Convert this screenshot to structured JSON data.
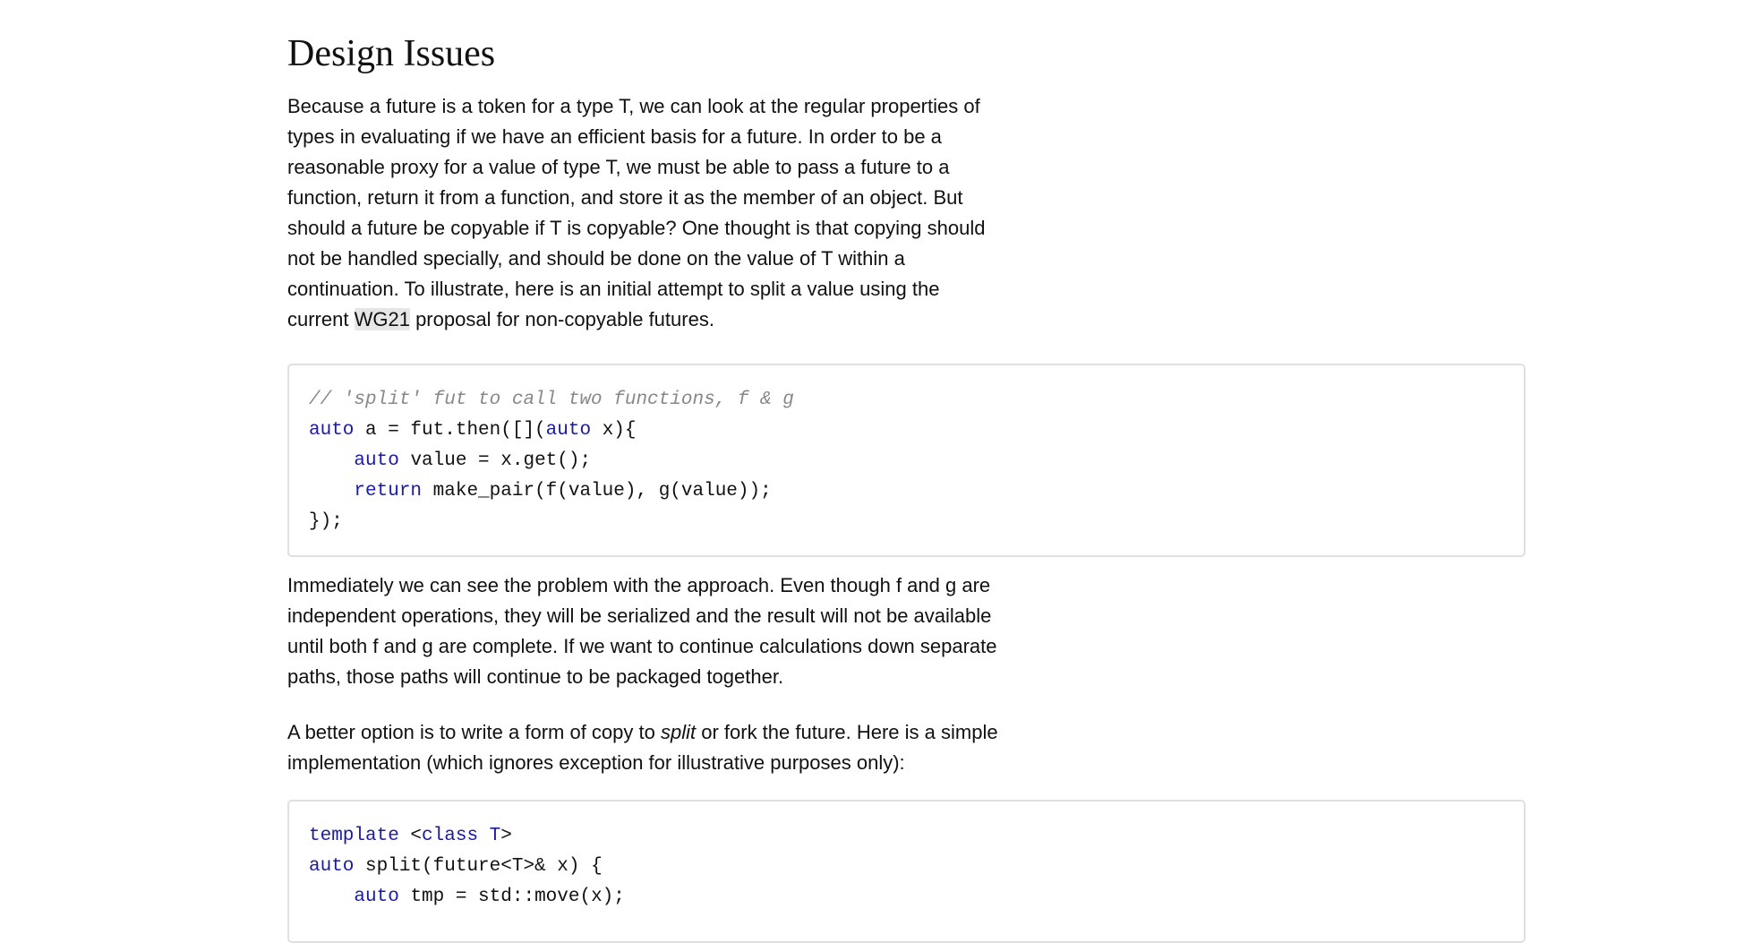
{
  "section_heading": "Design Issues",
  "para1": {
    "before": "Because a future is a token for a type T, we can look at the regular properties of types in evaluating if we have an efficient basis for a future. In order to be a reasonable proxy for a value of type T, we must be able to pass a future to a function, return it from a function, and store it as the member of an object. But should a future be copyable if T is copyable? One thought is that copying should not be handled specially, and should be done on the value of T within a continuation. To illustrate, here is an initial attempt to split a value using the current ",
    "highlight": "WG21",
    "after": " proposal for non-copyable futures."
  },
  "code1": [
    [
      {
        "t": "// 'split' fut to call two functions, f & g",
        "c": "cm"
      }
    ],
    [
      {
        "t": "auto",
        "c": "kw"
      },
      {
        "t": " a = fut.then([](",
        "c": ""
      },
      {
        "t": "auto",
        "c": "kw"
      },
      {
        "t": " x){",
        "c": ""
      }
    ],
    [
      {
        "t": "    ",
        "c": ""
      },
      {
        "t": "auto",
        "c": "kw"
      },
      {
        "t": " value = x.get();",
        "c": ""
      }
    ],
    [
      {
        "t": "    ",
        "c": ""
      },
      {
        "t": "return",
        "c": "kw"
      },
      {
        "t": " make_pair(f(value), g(value));",
        "c": ""
      }
    ],
    [
      {
        "t": "});",
        "c": ""
      }
    ]
  ],
  "para2": "Immediately we can see the problem with the approach. Even though f and g are independent operations, they will be serialized and the result will not be available until both f and g are complete. If we want to continue calculations down separate paths, those paths will continue to be packaged together.",
  "para3": {
    "before": "A better option is to write a form of copy to ",
    "emph": "split",
    "after": " or fork the future. Here is a simple implementation (which ignores exception for illustrative purposes only):"
  },
  "code2": [
    [
      {
        "t": "template",
        "c": "kw"
      },
      {
        "t": " <",
        "c": ""
      },
      {
        "t": "class",
        "c": "kw"
      },
      {
        "t": " ",
        "c": ""
      },
      {
        "t": "T",
        "c": "kw"
      },
      {
        "t": ">",
        "c": ""
      }
    ],
    [
      {
        "t": "auto",
        "c": "kw"
      },
      {
        "t": " split(future<T>& x) {",
        "c": ""
      }
    ],
    [
      {
        "t": "    ",
        "c": ""
      },
      {
        "t": "auto",
        "c": "kw"
      },
      {
        "t": " tmp = std::move(x);",
        "c": ""
      }
    ]
  ],
  "colors": {
    "keyword": "#1a1aa6",
    "comment": "#888888",
    "code_border": "#e0e0e0",
    "highlight_bg": "#e6e6e6"
  }
}
